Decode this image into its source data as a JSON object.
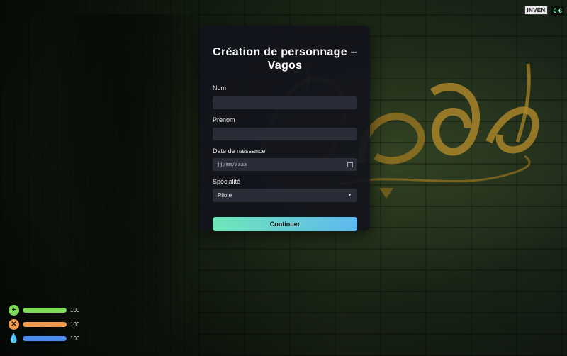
{
  "inventory": {
    "button_label": "INVEN",
    "money": "0 €"
  },
  "modal": {
    "title": "Création de personnage – Vagos",
    "fields": {
      "nom": {
        "label": "Nom",
        "value": "",
        "placeholder": ""
      },
      "prenom": {
        "label": "Prenom",
        "value": "",
        "placeholder": ""
      },
      "date": {
        "label": "Date de naissance",
        "placeholder": "jj/mm/aaaa"
      },
      "specialite": {
        "label": "Spécialité",
        "selected": "Pilote"
      }
    },
    "continue_label": "Continuer"
  },
  "hud": {
    "health": {
      "icon": "plus-icon",
      "value": "100",
      "level": 1.0,
      "color": "#7ed957"
    },
    "hunger": {
      "icon": "fork-knife-icon",
      "value": "100",
      "level": 1.0,
      "color": "#f29a4a"
    },
    "thirst": {
      "icon": "water-drop-icon",
      "value": "100",
      "level": 1.0,
      "color": "#4a8cf0"
    }
  },
  "background": {
    "graffiti_text": "Vagos"
  }
}
